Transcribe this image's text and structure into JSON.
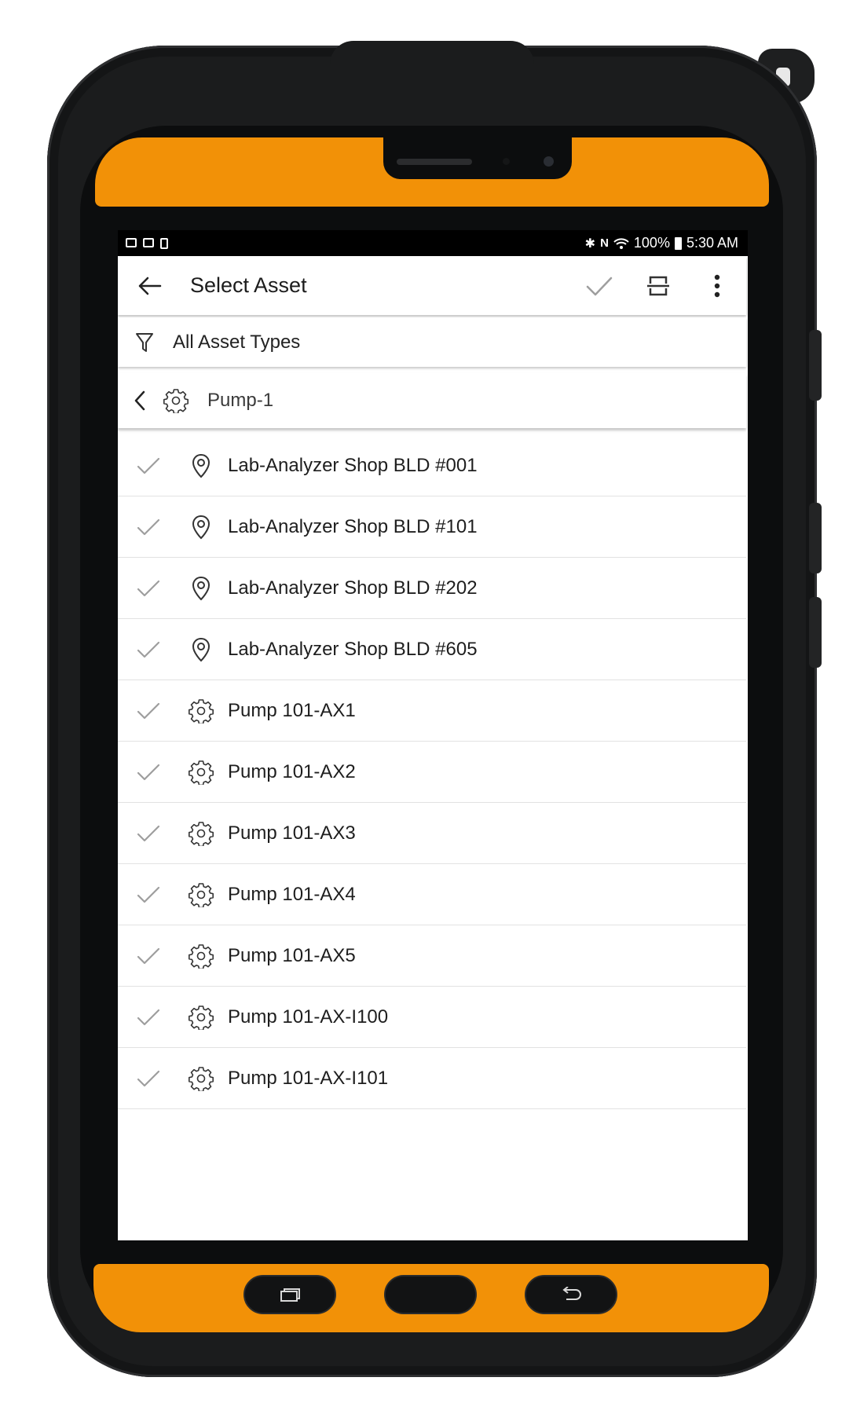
{
  "status_bar": {
    "left_icons": [
      "image-icon",
      "cast-icon",
      "battery-saver-icon"
    ],
    "battery": "100%",
    "time": "5:30 AM"
  },
  "app_bar": {
    "title": "Select Asset",
    "actions": [
      "check-icon",
      "scan-icon",
      "more-vert-icon"
    ]
  },
  "filter": {
    "label": "All Asset Types"
  },
  "breadcrumb": {
    "label": "Pump-1"
  },
  "assets": [
    {
      "label": "Lab-Analyzer Shop BLD #001",
      "icon": "location-icon"
    },
    {
      "label": "Lab-Analyzer Shop BLD #101",
      "icon": "location-icon"
    },
    {
      "label": "Lab-Analyzer Shop BLD #202",
      "icon": "location-icon"
    },
    {
      "label": "Lab-Analyzer Shop BLD #605",
      "icon": "location-icon"
    },
    {
      "label": "Pump 101-AX1",
      "icon": "gear-icon"
    },
    {
      "label": "Pump 101-AX2",
      "icon": "gear-icon"
    },
    {
      "label": "Pump 101-AX3",
      "icon": "gear-icon"
    },
    {
      "label": "Pump 101-AX4",
      "icon": "gear-icon"
    },
    {
      "label": "Pump 101-AX5",
      "icon": "gear-icon"
    },
    {
      "label": "Pump 101-AX-I100",
      "icon": "gear-icon"
    },
    {
      "label": "Pump 101-AX-I101",
      "icon": "gear-icon"
    }
  ],
  "colors": {
    "device_accent": "#f29107",
    "device_body": "#1b1c1d",
    "check_gray": "#9e9e9e"
  },
  "nav_buttons": [
    "recents-icon",
    "home-button",
    "back-nav-icon"
  ]
}
